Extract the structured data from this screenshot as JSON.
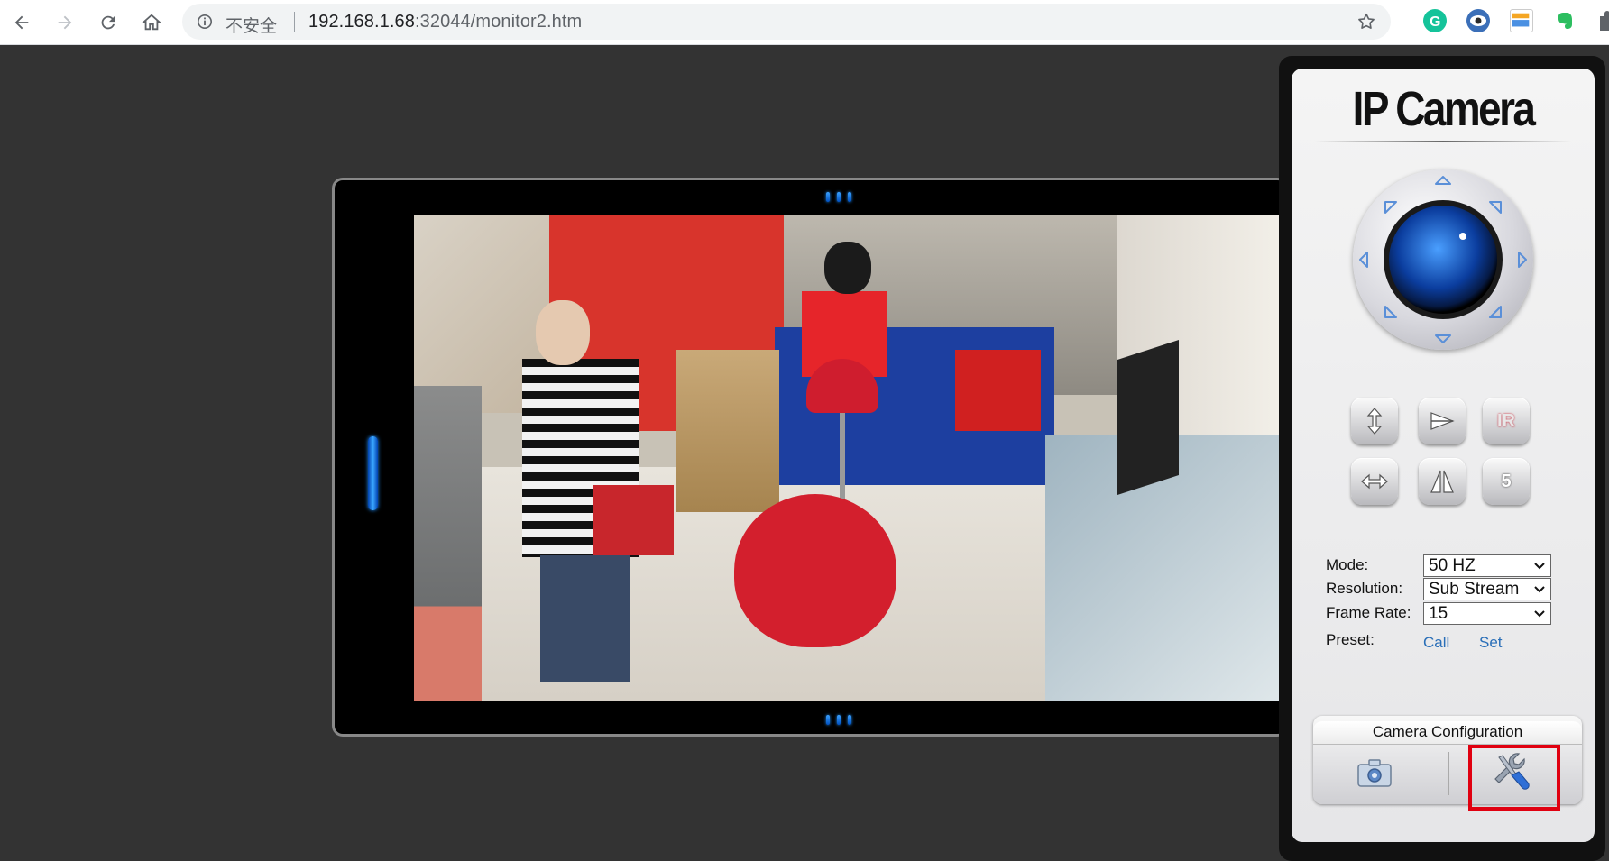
{
  "browser": {
    "insecure_label": "不安全",
    "url_host": "192.168.1.68",
    "url_path": ":32044/monitor2.htm"
  },
  "panel": {
    "logo": "IP Camera",
    "buttons": {
      "ir_label": "IR",
      "preset_number": "5"
    },
    "form": {
      "mode_label": "Mode:",
      "mode_value": "50 HZ",
      "resolution_label": "Resolution:",
      "resolution_value": "Sub Stream",
      "frame_rate_label": "Frame Rate:",
      "frame_rate_value": "15",
      "preset_label": "Preset:",
      "preset_call": "Call",
      "preset_set": "Set"
    },
    "config": {
      "title": "Camera Configuration"
    }
  },
  "colors": {
    "background": "#333333",
    "highlight": "#e00010",
    "link": "#2a6fb8"
  }
}
